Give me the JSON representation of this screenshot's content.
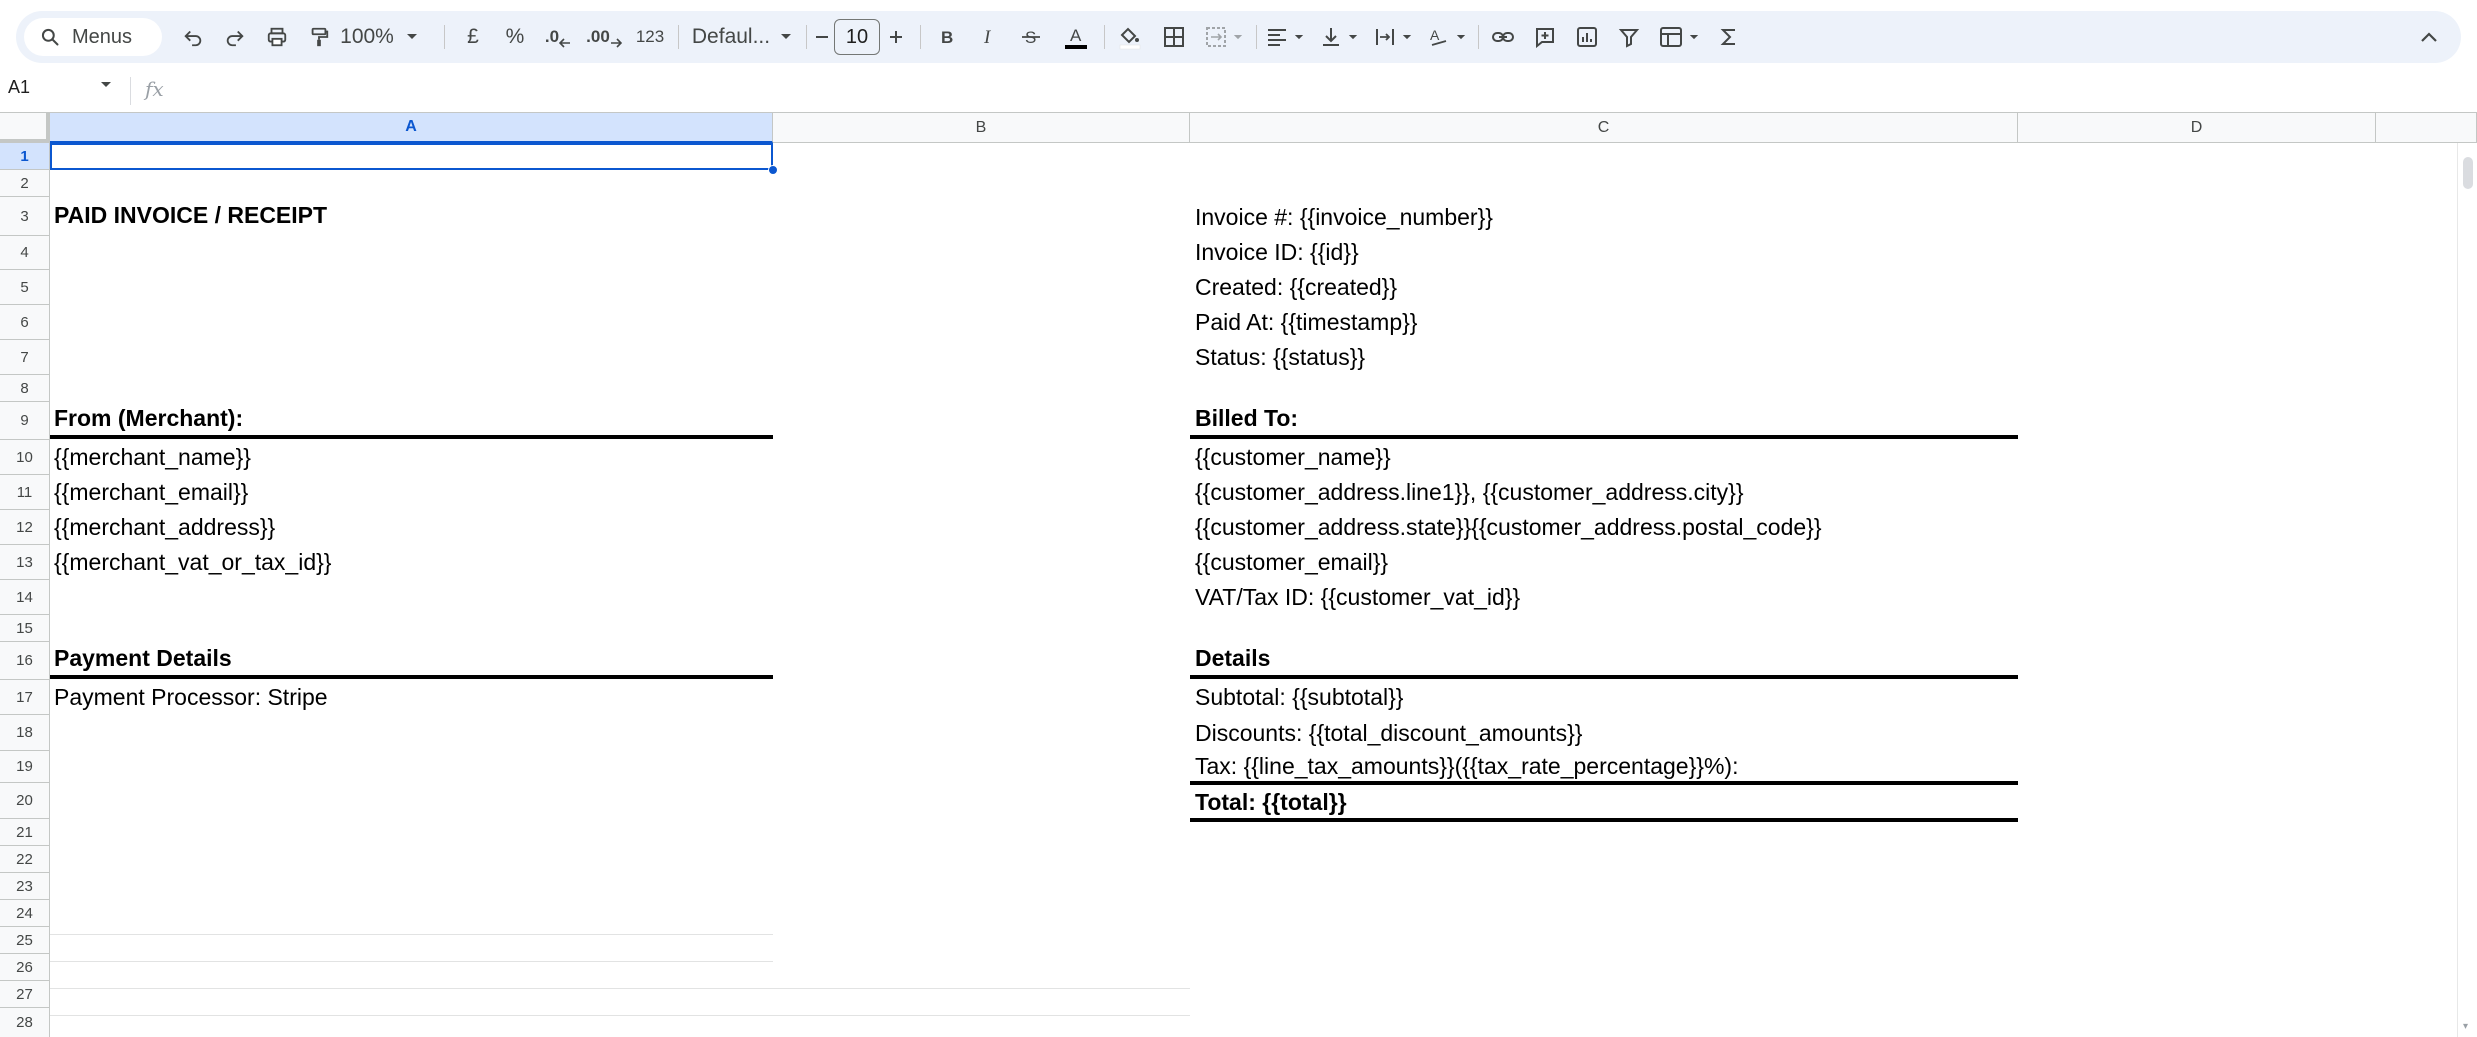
{
  "toolbar": {
    "menus_label": "Menus",
    "zoom": "100%",
    "currency_label": "£",
    "percent_label": "%",
    "dec_decrease_label": ".0",
    "dec_increase_label": ".00",
    "number_format_label": "123",
    "font_family": "Defaul...",
    "font_size": "10",
    "text_color": "#000000"
  },
  "formula_bar": {
    "name_box": "A1",
    "fx_label": "fx"
  },
  "columns": [
    {
      "label": "A"
    },
    {
      "label": "B"
    },
    {
      "label": "C"
    },
    {
      "label": "D"
    },
    {
      "label": ""
    }
  ],
  "rows": [
    "1",
    "2",
    "3",
    "4",
    "5",
    "6",
    "7",
    "8",
    "9",
    "10",
    "11",
    "12",
    "13",
    "14",
    "15",
    "16",
    "17",
    "18",
    "19",
    "20",
    "21",
    "22",
    "23",
    "24",
    "25",
    "26",
    "27",
    "28"
  ],
  "sheet": {
    "title": "PAID INVOICE / RECEIPT",
    "invoice_number": "Invoice #: {{invoice_number}}",
    "invoice_id": "Invoice ID: {{id}}",
    "created": "Created: {{created}}",
    "paid_at": "Paid At: {{timestamp}}",
    "status": "Status: {{status}}",
    "from_header": "From (Merchant):",
    "merchant_name": "{{merchant_name}}",
    "merchant_email": "{{merchant_email}}",
    "merchant_address": "{{merchant_address}}",
    "merchant_tax": "{{merchant_vat_or_tax_id}}",
    "billed_header": "Billed To:",
    "customer_name": "{{customer_name}}",
    "customer_address_1": "{{customer_address.line1}}, {{customer_address.city}}",
    "customer_address_2": "{{customer_address.state}}{{customer_address.postal_code}}",
    "customer_email": "{{customer_email}}",
    "customer_vat": "VAT/Tax ID: {{customer_vat_id}}",
    "payment_header": "Payment Details",
    "payment_processor": "Payment Processor: Stripe",
    "details_header": "Details",
    "subtotal": "Subtotal: {{subtotal}}",
    "discounts": "Discounts: {{total_discount_amounts}}",
    "tax": "Tax: {{line_tax_amounts}}({{tax_rate_percentage}}%):",
    "total": "Total: {{total}}"
  },
  "colors": {
    "accent": "#0b57d0",
    "selected_header": "#d3e3fd",
    "toolbar_bg": "#edf2fa"
  }
}
